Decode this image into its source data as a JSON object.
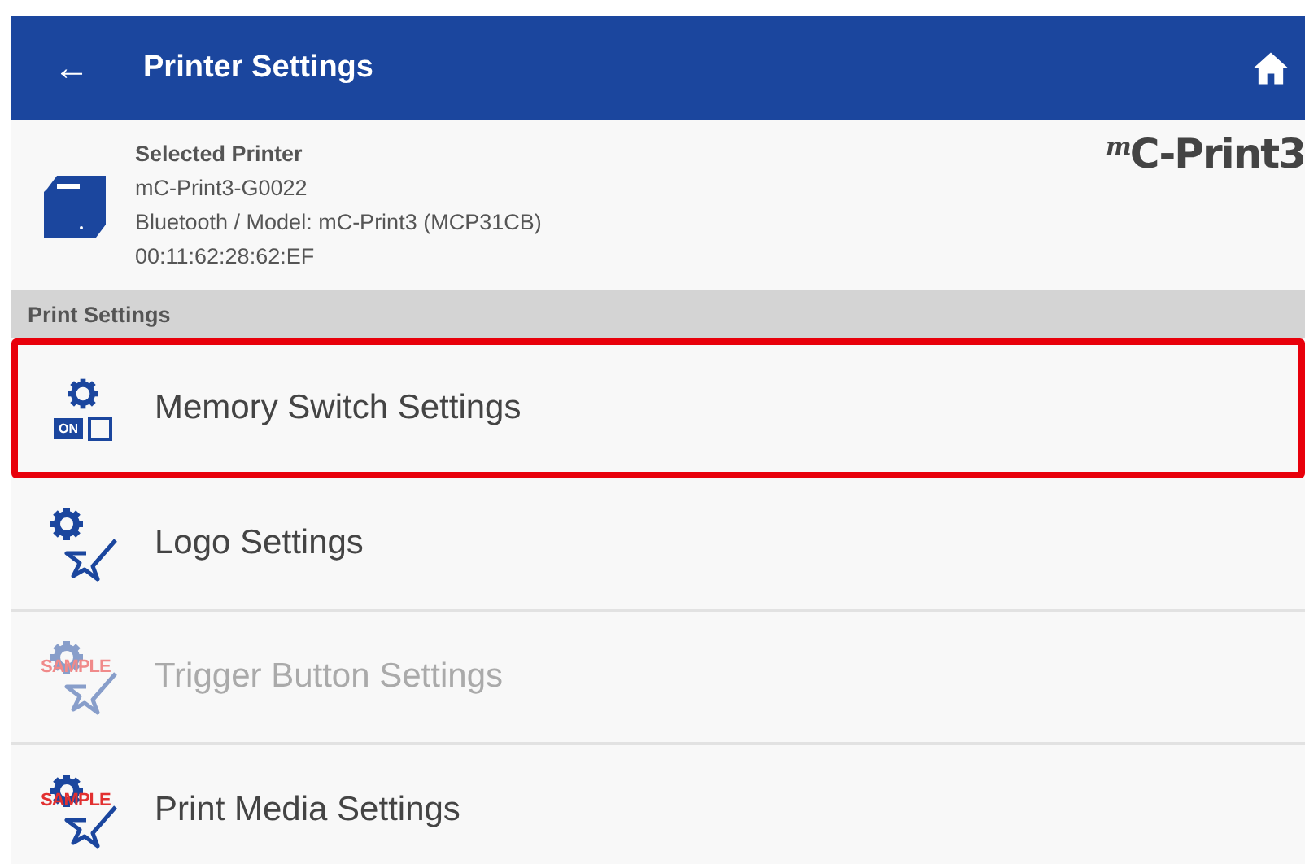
{
  "app_bar": {
    "back": "←",
    "title": "Printer Settings"
  },
  "printer": {
    "heading": "Selected Printer",
    "name": "mC-Print3-G0022",
    "connection": "Bluetooth / Model: mC-Print3 (MCP31CB)",
    "address": "00:11:62:28:62:EF",
    "brand_prefix": "m",
    "brand": "C-Print3"
  },
  "section": "Print Settings",
  "items": [
    {
      "kind": "switch",
      "label": "Memory Switch Settings",
      "badge": "ON",
      "disabled": false,
      "highlighted": true
    },
    {
      "kind": "logo",
      "label": "Logo Settings",
      "disabled": false,
      "highlighted": false
    },
    {
      "kind": "logo",
      "label": "Trigger Button Settings",
      "badge": "SAMPLE",
      "disabled": true,
      "highlighted": false
    },
    {
      "kind": "logo",
      "label": "Print Media Settings",
      "badge": "SAMPLE",
      "disabled": false,
      "highlighted": false
    }
  ]
}
